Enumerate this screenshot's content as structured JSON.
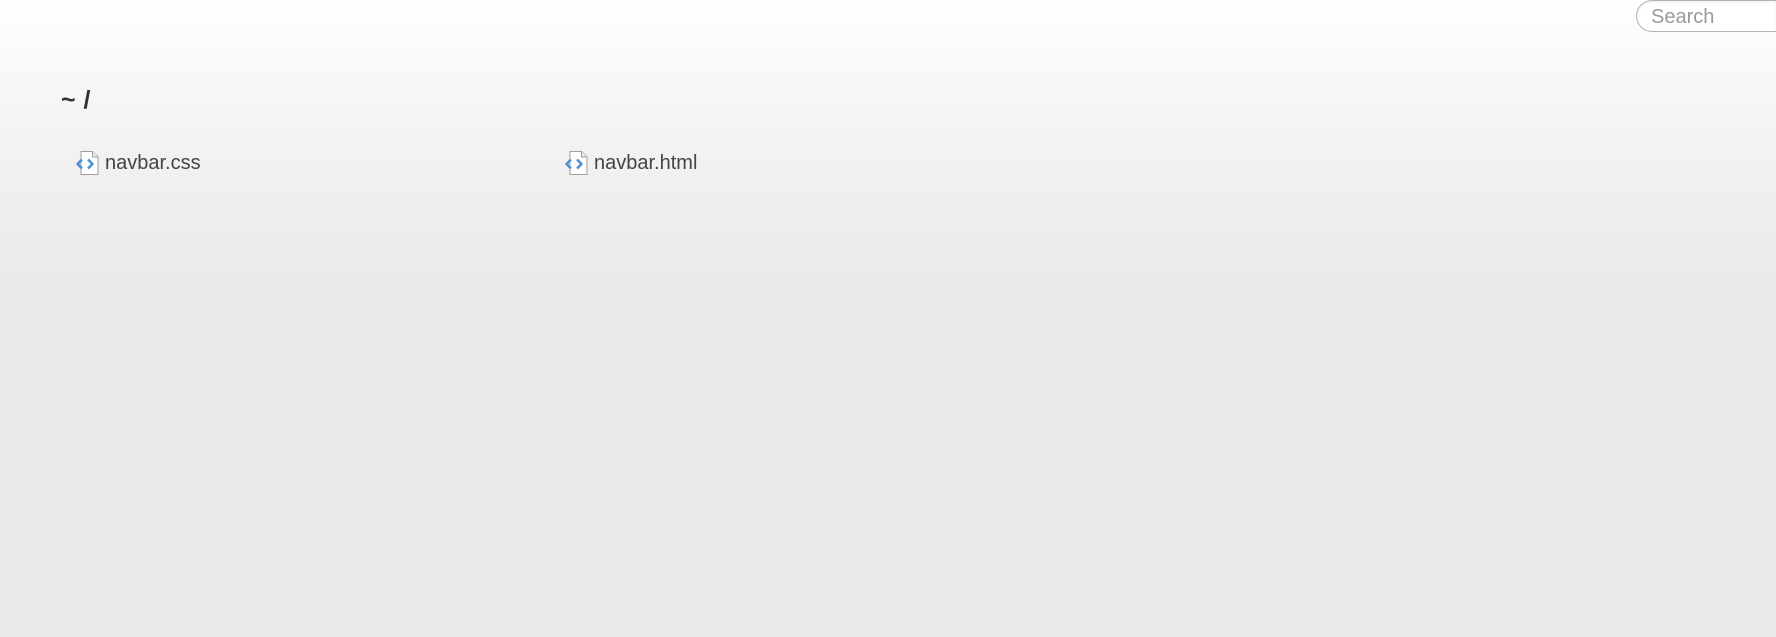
{
  "search": {
    "placeholder": "Search"
  },
  "breadcrumb": {
    "text": "~ /"
  },
  "files": [
    {
      "name": "navbar.css",
      "icon": "code-file-icon"
    },
    {
      "name": "navbar.html",
      "icon": "code-file-icon"
    }
  ],
  "colors": {
    "icon_accent": "#4a90d9",
    "text": "#444444"
  }
}
